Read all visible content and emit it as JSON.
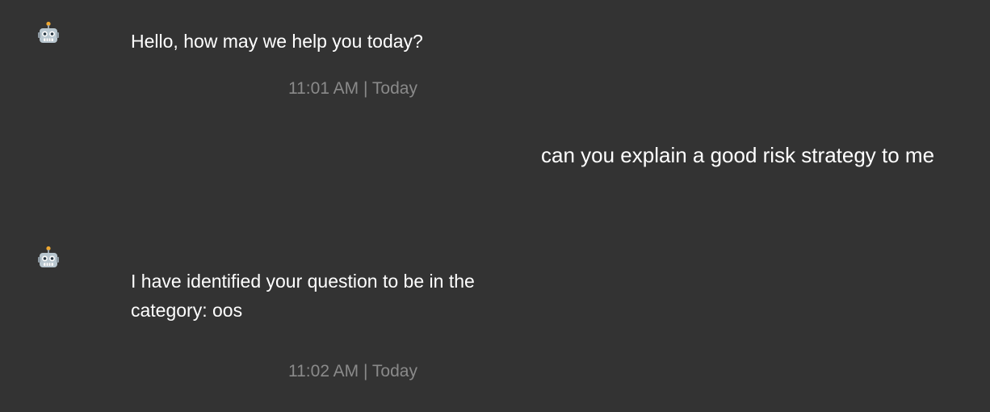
{
  "messages": [
    {
      "sender": "bot",
      "avatar_icon": "robot-face-icon",
      "text": "Hello, how may we help you today?",
      "timestamp": "11:01 AM | Today"
    },
    {
      "sender": "user",
      "text": "can you explain a good risk strategy to me"
    },
    {
      "sender": "bot",
      "avatar_icon": "robot-face-icon",
      "text": "I have identified your question to be in the category: oos",
      "timestamp": "11:02 AM | Today"
    }
  ],
  "colors": {
    "background": "#333333",
    "message_text": "#ffffff",
    "timestamp_text": "#8a8a8a"
  }
}
